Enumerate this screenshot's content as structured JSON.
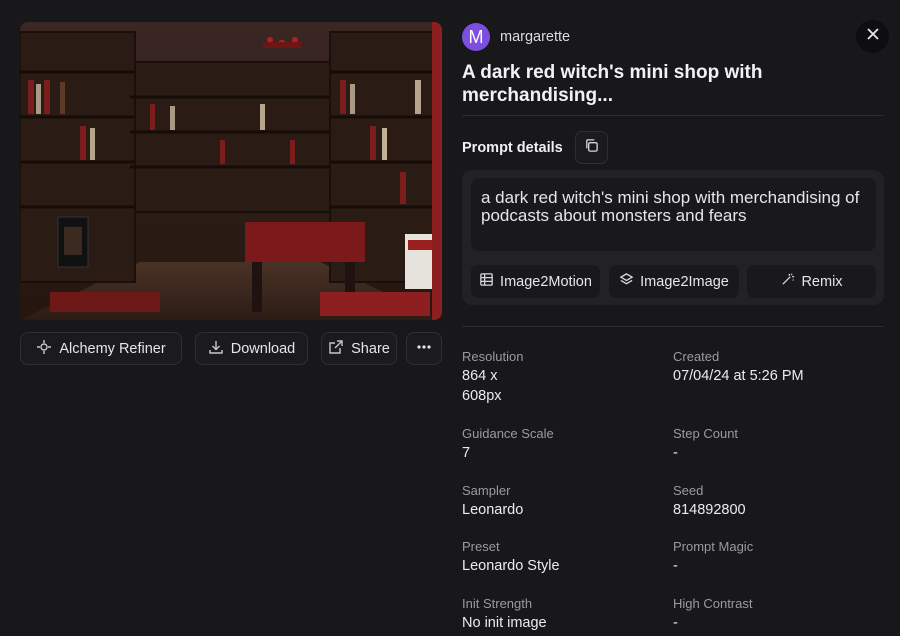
{
  "user": {
    "initial": "M",
    "name": "margarette",
    "avatar_color": "#7c4fe0"
  },
  "title": "A dark red witch's mini shop with merchandising...",
  "actions": {
    "alchemy_refiner": "Alchemy Refiner",
    "download": "Download",
    "share": "Share",
    "more_icon": "more-horizontal-icon"
  },
  "prompt": {
    "label": "Prompt details",
    "text": "a dark red witch's mini shop with merchandising of podcasts about monsters and fears",
    "buttons": {
      "image2motion": "Image2Motion",
      "image2image": "Image2Image",
      "remix": "Remix"
    }
  },
  "details": {
    "resolution": {
      "label": "Resolution",
      "line1": "864 x",
      "line2": "608px"
    },
    "created": {
      "label": "Created",
      "value": "07/04/24 at 5:26 PM"
    },
    "guidance_scale": {
      "label": "Guidance Scale",
      "value": "7"
    },
    "step_count": {
      "label": "Step Count",
      "value": "-"
    },
    "sampler": {
      "label": "Sampler",
      "value": "Leonardo"
    },
    "seed": {
      "label": "Seed",
      "value": "814892800"
    },
    "preset": {
      "label": "Preset",
      "value": "Leonardo Style"
    },
    "prompt_magic": {
      "label": "Prompt Magic",
      "value": "-"
    },
    "init_strength": {
      "label": "Init Strength",
      "value": "No init image"
    },
    "high_contrast": {
      "label": "High Contrast",
      "value": "-"
    }
  },
  "colors": {
    "background": "#18181a",
    "panel": "#222225",
    "accent": "#7c4fe0",
    "image_red": "#8e1f20"
  }
}
